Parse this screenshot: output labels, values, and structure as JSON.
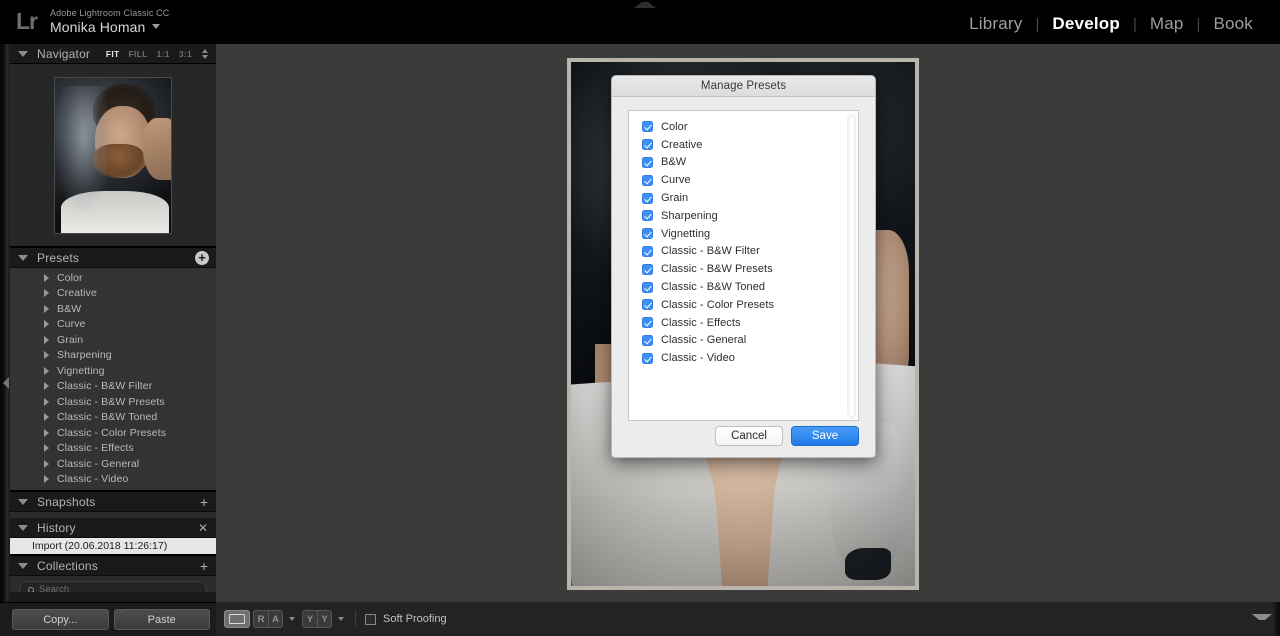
{
  "header": {
    "logo": "Lr",
    "app_name": "Adobe Lightroom Classic CC",
    "user_name": "Monika Homan",
    "user_caret_icon": "caret-down-icon",
    "modules": [
      {
        "label": "Library",
        "active": false
      },
      {
        "label": "Develop",
        "active": true
      },
      {
        "label": "Map",
        "active": false
      },
      {
        "label": "Book",
        "active": false
      }
    ],
    "separator": "|"
  },
  "left_panel": {
    "navigator": {
      "title": "Navigator",
      "zoom_levels": [
        {
          "label": "FIT",
          "active": true
        },
        {
          "label": "FILL",
          "active": false
        },
        {
          "label": "1:1",
          "active": false
        },
        {
          "label": "3:1",
          "active": false
        }
      ],
      "stepper_icon": "stepper-updown-icon"
    },
    "presets": {
      "title": "Presets",
      "add_icon": "plus-circle-icon",
      "groups": [
        "Color",
        "Creative",
        "B&W",
        "Curve",
        "Grain",
        "Sharpening",
        "Vignetting",
        "Classic - B&W Filter",
        "Classic - B&W Presets",
        "Classic - B&W Toned",
        "Classic - Color Presets",
        "Classic - Effects",
        "Classic - General",
        "Classic - Video"
      ]
    },
    "snapshots": {
      "title": "Snapshots",
      "add_icon": "plus-icon"
    },
    "history": {
      "title": "History",
      "clear_icon": "close-x-icon",
      "entries": [
        "Import (20.06.2018 11:26:17)"
      ]
    },
    "collections": {
      "title": "Collections",
      "add_icon": "plus-icon",
      "search_placeholder": "Search",
      "search_icon": "search-icon"
    },
    "collapse_icon": "triangle-left-icon"
  },
  "dialog": {
    "title": "Manage Presets",
    "items": [
      {
        "label": "Color",
        "checked": true
      },
      {
        "label": "Creative",
        "checked": true
      },
      {
        "label": "B&W",
        "checked": true
      },
      {
        "label": "Curve",
        "checked": true
      },
      {
        "label": "Grain",
        "checked": true
      },
      {
        "label": "Sharpening",
        "checked": true
      },
      {
        "label": "Vignetting",
        "checked": true
      },
      {
        "label": "Classic - B&W Filter",
        "checked": true
      },
      {
        "label": "Classic - B&W Presets",
        "checked": true
      },
      {
        "label": "Classic - B&W Toned",
        "checked": true
      },
      {
        "label": "Classic - Color Presets",
        "checked": true
      },
      {
        "label": "Classic - Effects",
        "checked": true
      },
      {
        "label": "Classic - General",
        "checked": true
      },
      {
        "label": "Classic - Video",
        "checked": true
      }
    ],
    "cancel_label": "Cancel",
    "save_label": "Save",
    "accent_color": "#2f7de4"
  },
  "bottom_bar": {
    "copy_label": "Copy...",
    "paste_label": "Paste",
    "view_loupe_icon": "loupe-view-icon",
    "view_before_after_left": "R",
    "view_before_after_right": "A",
    "view_yy_left": "Y",
    "view_yy_right": "Y",
    "soft_proofing_label": "Soft Proofing",
    "soft_proofing_checked": false,
    "filmstrip_toggle_icon": "chevron-down-icon"
  },
  "top_toggle_icon": "chevron-up-icon"
}
